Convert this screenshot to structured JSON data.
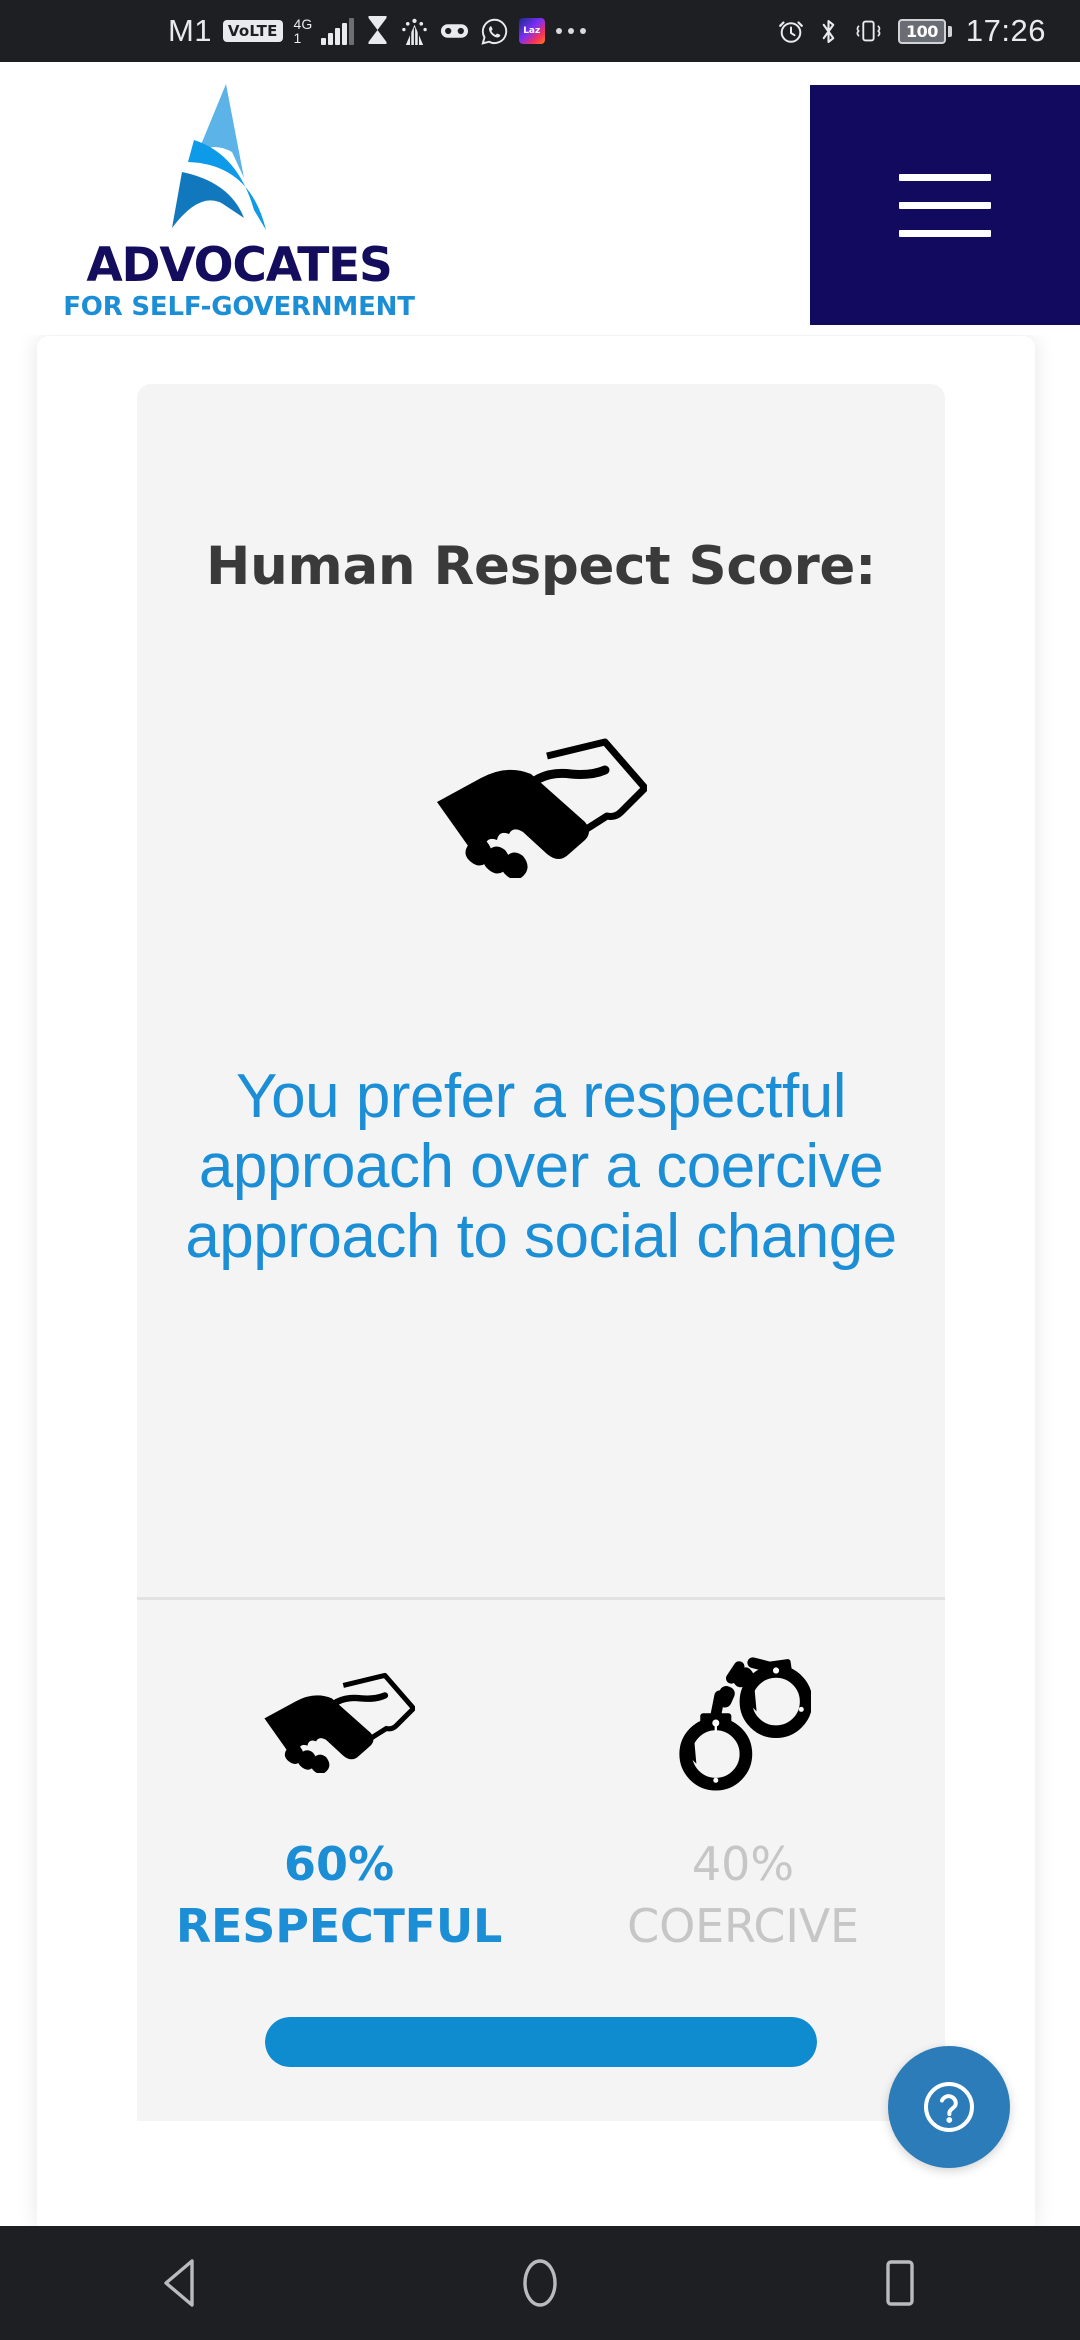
{
  "status_bar": {
    "carrier": "M1",
    "volte_badge": "VoLTE",
    "network_type": "4G",
    "network_sub": "1",
    "battery_level": "100",
    "time": "17:26",
    "left_icons": [
      "carrier-label",
      "volte-icon",
      "signal-icon",
      "hourglass-icon",
      "fireworks-icon",
      "mask-icon",
      "whatsapp-icon",
      "lazada-icon",
      "more-icons"
    ],
    "right_icons": [
      "alarm-icon",
      "bluetooth-icon",
      "vibrate-icon",
      "battery-icon"
    ]
  },
  "header": {
    "logo_word": "ADVOCATES",
    "logo_sub": "FOR SELF-GOVERNMENT",
    "logo_colors": {
      "word": "#140d5e",
      "sub": "#1b8ed6",
      "mark_light": "#5cb3e8",
      "mark_mid": "#0d9ae8",
      "mark_dark": "#1278bd"
    },
    "menu_label": "Menu",
    "menu_bg": "#120a5e"
  },
  "card": {
    "title": "Human Respect Score:",
    "hero_icon": "handshake-icon",
    "result_text": "You prefer a respectful approach over a coercive approach to social change",
    "result_color": "#1b8ed6",
    "breakdown": [
      {
        "icon": "handshake-icon",
        "percent": "60%",
        "label": "RESPECTFUL",
        "color": "#1b8ed6",
        "active": true
      },
      {
        "icon": "handcuffs-icon",
        "percent": "40%",
        "label": "COERCIVE",
        "color": "#c6c6c6",
        "active": false
      }
    ],
    "progress": {
      "value": 100,
      "fill_color": "#0f8cd0",
      "track_color": "#e6e6e6"
    }
  },
  "help_button": {
    "icon": "question-mark-icon",
    "label": "Help",
    "color": "#2b7cb8"
  },
  "nav_bar": {
    "back_label": "Back",
    "home_label": "Home",
    "recents_label": "Recents"
  },
  "chart_data": {
    "type": "bar",
    "title": "Human Respect Score:",
    "categories": [
      "RESPECTFUL",
      "COERCIVE"
    ],
    "values": [
      60,
      40
    ],
    "unit": "%",
    "xlabel": "",
    "ylabel": "",
    "ylim": [
      0,
      100
    ],
    "colors": [
      "#1b8ed6",
      "#c6c6c6"
    ],
    "legend": "none",
    "grid": false,
    "annotations": [
      "You prefer a respectful approach over a coercive approach to social change"
    ]
  }
}
